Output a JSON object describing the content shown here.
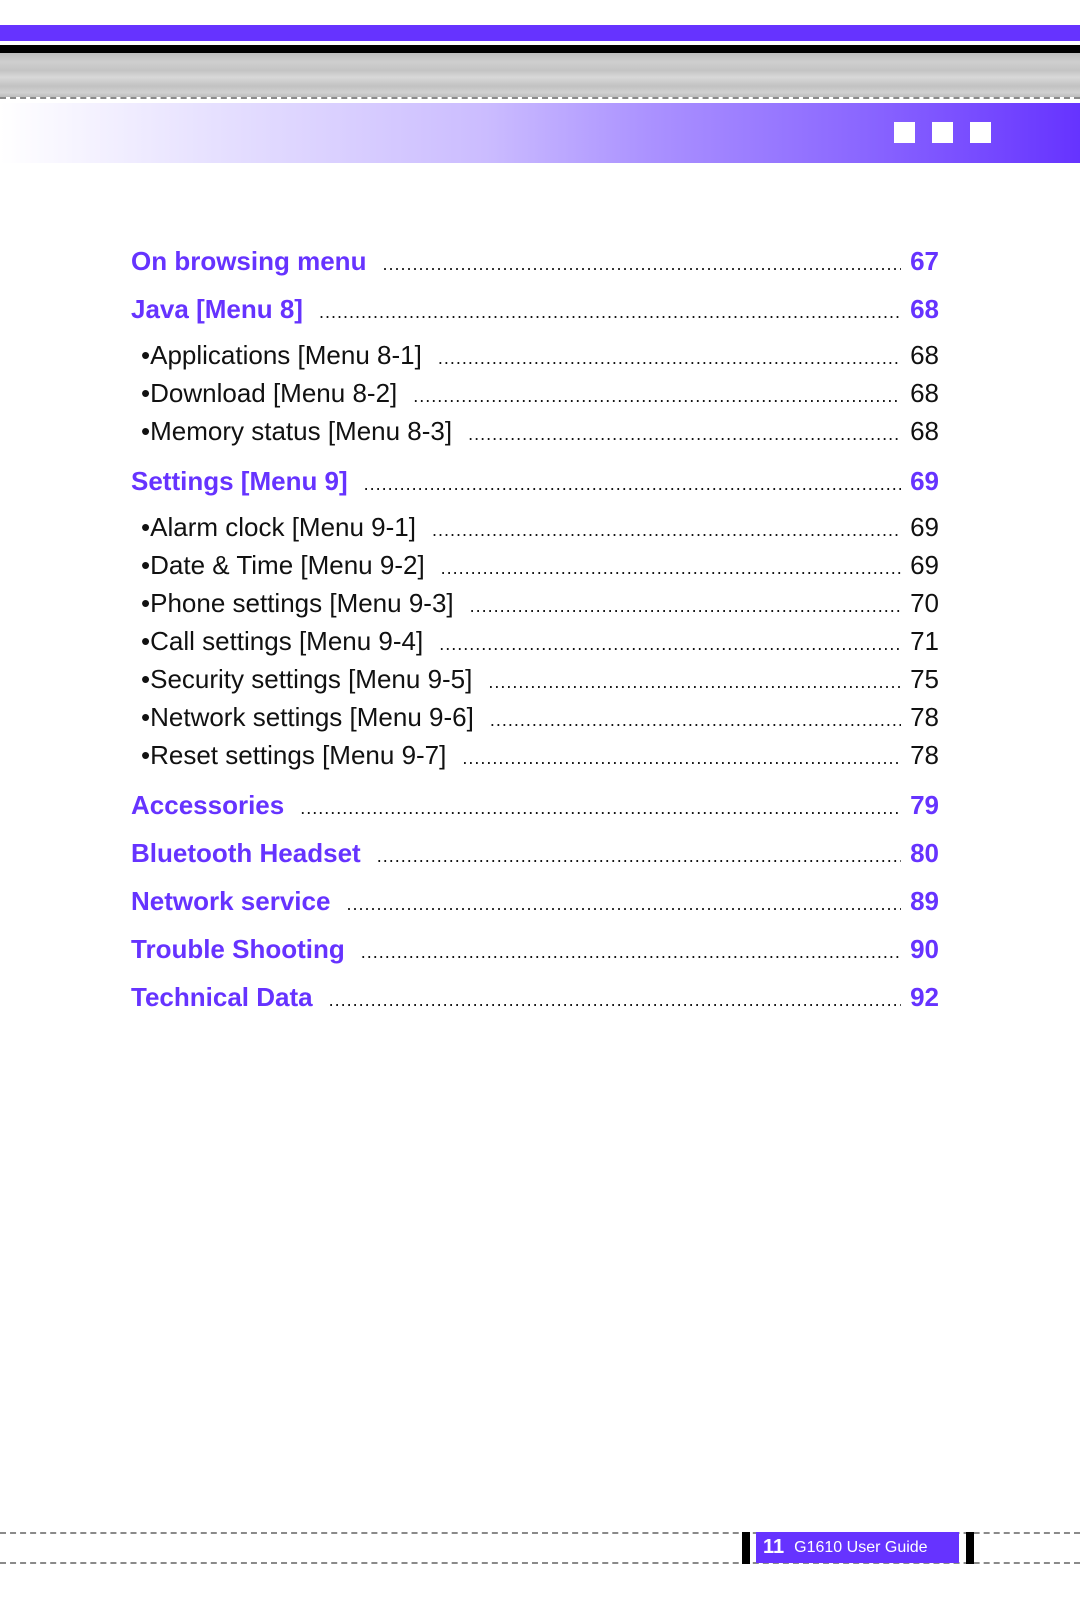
{
  "header": {
    "decoration_squares": 3,
    "accent_color": "#6633ff"
  },
  "toc": {
    "entries": [
      {
        "level": "main",
        "label": "On browsing menu",
        "page": "67"
      },
      {
        "level": "main",
        "label": "Java [Menu 8]",
        "page": "68"
      },
      {
        "level": "sub",
        "label": "Applications [Menu 8-1]",
        "page": "68"
      },
      {
        "level": "sub",
        "label": "Download [Menu 8-2]",
        "page": "68"
      },
      {
        "level": "sub",
        "label": "Memory status [Menu 8-3]",
        "page": "68"
      },
      {
        "level": "main",
        "label": "Settings [Menu 9]",
        "page": "69"
      },
      {
        "level": "sub",
        "label": "Alarm clock [Menu 9-1]",
        "page": "69"
      },
      {
        "level": "sub",
        "label": "Date & Time [Menu 9-2]",
        "page": "69"
      },
      {
        "level": "sub",
        "label": "Phone settings [Menu 9-3]",
        "page": "70"
      },
      {
        "level": "sub",
        "label": "Call settings [Menu 9-4]",
        "page": "71"
      },
      {
        "level": "sub",
        "label": "Security settings [Menu 9-5]",
        "page": "75"
      },
      {
        "level": "sub",
        "label": "Network settings [Menu 9-6]",
        "page": "78"
      },
      {
        "level": "sub",
        "label": "Reset settings [Menu 9-7]",
        "page": "78"
      },
      {
        "level": "main",
        "label": "Accessories",
        "page": "79"
      },
      {
        "level": "main",
        "label": "Bluetooth Headset",
        "page": "80"
      },
      {
        "level": "main",
        "label": "Network service",
        "page": "89"
      },
      {
        "level": "main",
        "label": "Trouble Shooting",
        "page": "90"
      },
      {
        "level": "main",
        "label": "Technical Data",
        "page": "92"
      }
    ],
    "bullet": "•"
  },
  "footer": {
    "page_number": "11",
    "document_title": "G1610 User Guide"
  }
}
